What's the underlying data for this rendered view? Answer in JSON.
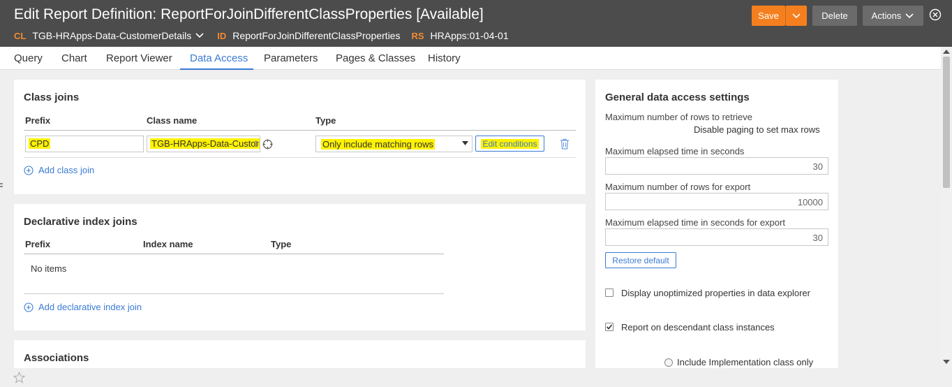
{
  "header": {
    "title": "Edit Report Definition: ReportForJoinDifferentClassProperties [Available]",
    "cl_key": "CL",
    "cl_value": "TGB-HRApps-Data-CustomerDetails",
    "id_key": "ID",
    "id_value": "ReportForJoinDifferentClassProperties",
    "rs_key": "RS",
    "rs_value": "HRApps:01-04-01",
    "save_label": "Save",
    "delete_label": "Delete",
    "actions_label": "Actions"
  },
  "tabs": [
    {
      "label": "Query"
    },
    {
      "label": "Chart"
    },
    {
      "label": "Report Viewer"
    },
    {
      "label": "Data Access"
    },
    {
      "label": "Parameters"
    },
    {
      "label": "Pages & Classes"
    },
    {
      "label": "History"
    }
  ],
  "class_joins": {
    "title": "Class joins",
    "col_prefix": "Prefix",
    "col_class": "Class name",
    "col_type": "Type",
    "row": {
      "prefix": "CPD",
      "class_name": "TGB-HRApps-Data-Custor",
      "type": "Only include matching rows",
      "edit_label": "Edit conditions"
    },
    "add_label": "Add class join"
  },
  "index_joins": {
    "title": "Declarative index joins",
    "col_prefix": "Prefix",
    "col_index": "Index name",
    "col_type": "Type",
    "empty": "No items",
    "add_label": "Add declarative index join"
  },
  "associations": {
    "title": "Associations"
  },
  "settings": {
    "title": "General data access settings",
    "max_rows_label": "Maximum number of rows to retrieve",
    "paging_note": "Disable paging to set max rows",
    "max_time_label": "Maximum elapsed time in seconds",
    "max_time_value": "30",
    "max_export_rows_label": "Maximum number of rows for export",
    "max_export_rows_value": "10000",
    "max_export_time_label": "Maximum elapsed time in seconds for export",
    "max_export_time_value": "30",
    "restore_label": "Restore default",
    "unoptimized_label": "Display unoptimized properties in data explorer",
    "descendant_label": "Report on descendant class instances",
    "impl_label": "Include Implementation class only"
  },
  "colors": {
    "accent": "#3a7bd5",
    "save": "#f57f1e",
    "highlight": "#fff200"
  }
}
